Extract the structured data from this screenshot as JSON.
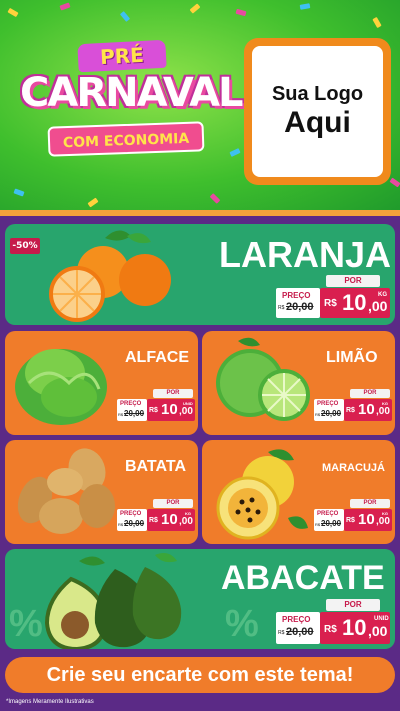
{
  "header": {
    "badge_top": "PRÉ",
    "badge_main": "CARNAVAL",
    "badge_sub": "COM ECONOMIA",
    "logo_line1": "Sua Logo",
    "logo_line2": "Aqui"
  },
  "products": {
    "laranja": {
      "name": "LARANJA",
      "discount": "-50%",
      "por": "POR",
      "preco": "PREÇO",
      "old_cur": "R$",
      "old": "20,00",
      "cur": "R$",
      "int": "10",
      "dec": ",00",
      "unit": "KG"
    },
    "alface": {
      "name": "ALFACE",
      "por": "POR",
      "preco": "PREÇO",
      "old_cur": "R$",
      "old": "20,00",
      "cur": "R$",
      "int": "10",
      "dec": ",00",
      "unit": "UNID"
    },
    "limao": {
      "name": "LIMÃO",
      "por": "POR",
      "preco": "PREÇO",
      "old_cur": "R$",
      "old": "20,00",
      "cur": "R$",
      "int": "10",
      "dec": ",00",
      "unit": "KG"
    },
    "batata": {
      "name": "BATATA",
      "por": "POR",
      "preco": "PREÇO",
      "old_cur": "R$",
      "old": "20,00",
      "cur": "R$",
      "int": "10",
      "dec": ",00",
      "unit": "KG"
    },
    "maracuja": {
      "name": "MARACUJÁ",
      "por": "POR",
      "preco": "PREÇO",
      "old_cur": "R$",
      "old": "20,00",
      "cur": "R$",
      "int": "10",
      "dec": ",00",
      "unit": "KG"
    },
    "abacate": {
      "name": "ABACATE",
      "por": "POR",
      "preco": "PREÇO",
      "old_cur": "R$",
      "old": "20,00",
      "cur": "R$",
      "int": "10",
      "dec": ",00",
      "unit": "UNID"
    }
  },
  "cta": "Crie seu encarte com este tema!",
  "footer_note": "*Imagens Meramente Ilustrativas",
  "colors": {
    "green": "#28a56d",
    "orange": "#f07c2a",
    "purple": "#5b2a86",
    "price_red": "#d91f4f"
  }
}
